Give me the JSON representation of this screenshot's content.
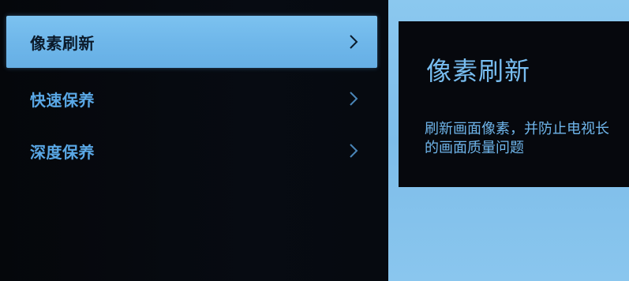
{
  "menu": {
    "items": [
      {
        "label": "像素刷新",
        "selected": true
      },
      {
        "label": "快速保养",
        "selected": false
      },
      {
        "label": "深度保养",
        "selected": false
      }
    ],
    "chevron_icon": "chevron-right-icon"
  },
  "detail": {
    "title": "像素刷新",
    "description_line1": "刷新画面像素，并防止电视长",
    "description_line2": "的画面质量问题"
  },
  "colors": {
    "selected_bg": "#6fb7ea",
    "text_blue": "#5aa8e6",
    "panel_bg": "#06080d",
    "right_bg": "#7dbde9"
  }
}
